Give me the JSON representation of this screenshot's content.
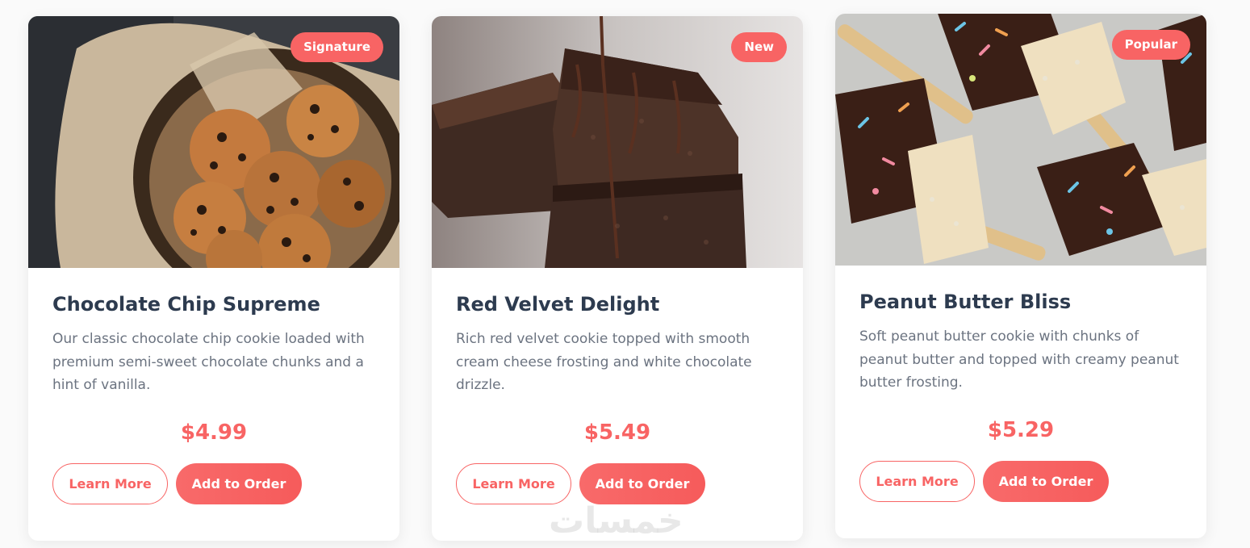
{
  "colors": {
    "accent": "#f86464",
    "title": "#2d3b4f",
    "text": "#6b7380",
    "card_bg": "#ffffff",
    "page_bg": "#fafafa"
  },
  "products": [
    {
      "badge": "Signature",
      "title": "Chocolate Chip Supreme",
      "description": "Our classic chocolate chip cookie loaded with premium semi-sweet chocolate chunks and a hint of vanilla.",
      "price": "$4.99",
      "learn_more_label": "Learn More",
      "add_to_order_label": "Add to Order",
      "image": "chocolate-chip-cookies-photo"
    },
    {
      "badge": "New",
      "title": "Red Velvet Delight",
      "description": "Rich red velvet cookie topped with smooth cream cheese frosting and white chocolate drizzle.",
      "price": "$5.49",
      "learn_more_label": "Learn More",
      "add_to_order_label": "Add to Order",
      "image": "chocolate-cake-drizzle-photo"
    },
    {
      "badge": "Popular",
      "title": "Peanut Butter Bliss",
      "description": "Soft peanut butter cookie with chunks of peanut butter and topped with creamy peanut butter frosting.",
      "price": "$5.29",
      "learn_more_label": "Learn More",
      "add_to_order_label": "Add to Order",
      "image": "rice-crispy-treat-pops-photo"
    }
  ],
  "watermark": "خمسات"
}
